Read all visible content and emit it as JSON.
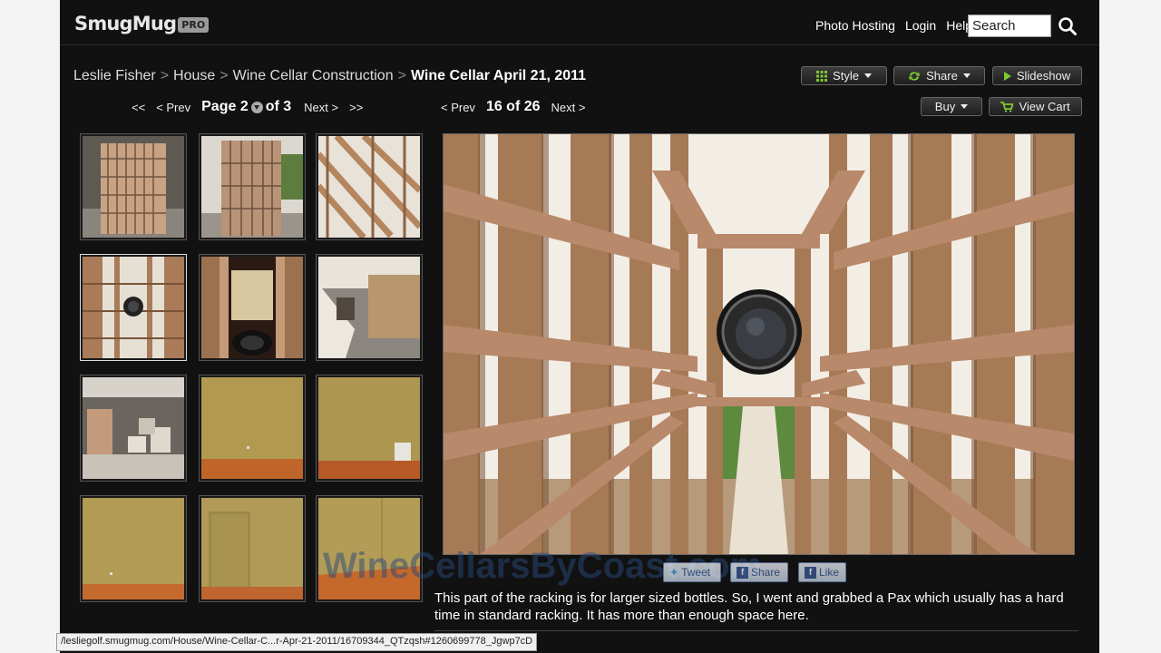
{
  "header": {
    "logo": "SmugMug",
    "logo_badge": "PRO",
    "links": [
      "Photo Hosting",
      "Login",
      "Help"
    ],
    "search_value": "Search"
  },
  "breadcrumb": {
    "items": [
      "Leslie Fisher",
      "House",
      "Wine Cellar Construction"
    ],
    "current": "Wine Cellar April 21, 2011",
    "separator": ">"
  },
  "toolbar": {
    "style_label": "Style",
    "share_label": "Share",
    "slideshow_label": "Slideshow",
    "buy_label": "Buy",
    "view_cart_label": "View Cart"
  },
  "page_pager": {
    "first": "<<",
    "prev": "< Prev",
    "page_label": "Page 2",
    "of_label": "of 3",
    "next": "Next >",
    "last": ">>"
  },
  "photo_pager": {
    "prev": "< Prev",
    "position": "16 of 26",
    "next": "Next >"
  },
  "thumbnails": [
    {
      "scene": "rack-front"
    },
    {
      "scene": "rack-garage"
    },
    {
      "scene": "rack-angle"
    },
    {
      "scene": "rack-bottle-tunnel",
      "selected": true
    },
    {
      "scene": "bottle-label"
    },
    {
      "scene": "room-interior"
    },
    {
      "scene": "garage-boxes"
    },
    {
      "scene": "wall-floor"
    },
    {
      "scene": "wall-box"
    },
    {
      "scene": "wall-plain"
    },
    {
      "scene": "doorway"
    },
    {
      "scene": "wall-corner"
    }
  ],
  "social": {
    "tweet": "Tweet",
    "share": "Share",
    "like": "Like"
  },
  "watermark": "WineCellarsByCoast.com",
  "caption": "This part of the racking is for larger sized bottles. So, I went and grabbed a Pax which usually has a hard time in standard racking. It has more than enough space here.",
  "status_url": "/lesliegolf.smugmug.com/House/Wine-Cellar-C...r-Apr-21-2011/16709344_QTzqsh#1260699778_Jgwp7cD",
  "colors": {
    "background": "#111111",
    "wood": "#a97b58",
    "wood_dark": "#6e4a33",
    "wall": "#b19a4f",
    "floor": "#c0652a"
  }
}
